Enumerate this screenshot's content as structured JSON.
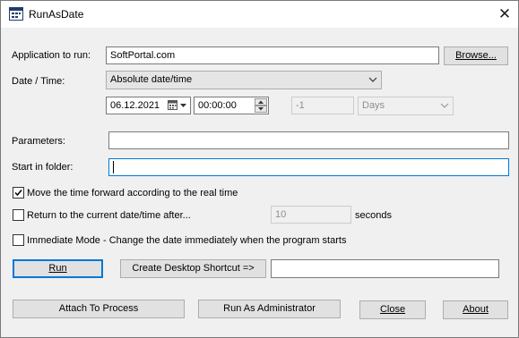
{
  "window": {
    "title": "RunAsDate",
    "close_glyph": "✕"
  },
  "form": {
    "app_label": "Application to run:",
    "app_value": "SoftPortal.com",
    "browse_label": "Browse...",
    "datetime_label": "Date / Time:",
    "datetime_mode": "Absolute date/time",
    "date_value": "06.12.2021",
    "time_value": "00:00:00",
    "offset_value": "-1",
    "offset_unit": "Days",
    "params_label": "Parameters:",
    "params_value": "",
    "startin_label": "Start in folder:",
    "startin_value": ""
  },
  "options": {
    "move_forward": {
      "label": "Move the time forward according to the real time",
      "checked": true
    },
    "return_after": {
      "label": "Return to the current date/time after...",
      "checked": false,
      "value": "10",
      "unit": "seconds"
    },
    "immediate": {
      "label": "Immediate Mode - Change the date immediately when the program starts",
      "checked": false
    }
  },
  "buttons": {
    "run": "Run",
    "shortcut": "Create Desktop Shortcut =>",
    "shortcut_name": "",
    "attach": "Attach To Process",
    "run_admin": "Run As Administrator",
    "close": "Close",
    "about": "About"
  },
  "icons": {
    "app": "app-window-icon",
    "calendar": "calendar-dropdown-icon",
    "spin": "spin-updown-icon",
    "check": "checkmark-icon"
  }
}
